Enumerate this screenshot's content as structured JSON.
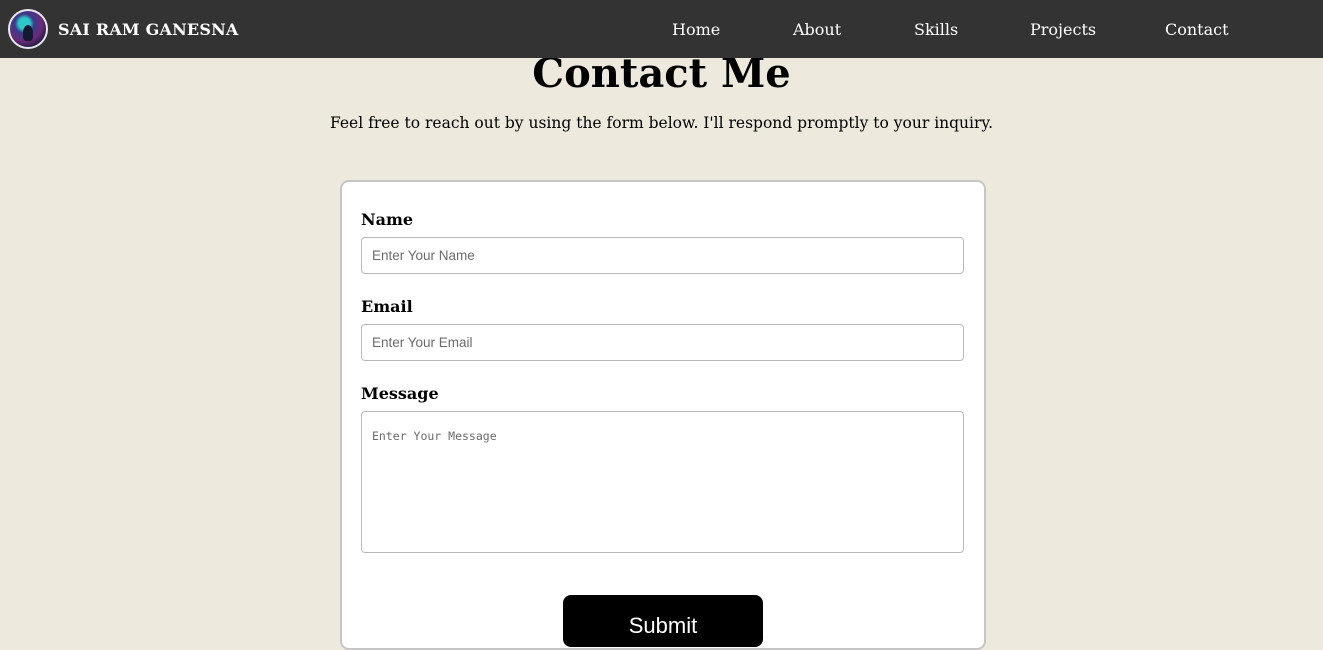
{
  "navbar": {
    "brand_name": "SAI RAM GANESNA",
    "links": [
      {
        "label": "Home"
      },
      {
        "label": "About"
      },
      {
        "label": "Skills"
      },
      {
        "label": "Projects"
      },
      {
        "label": "Contact"
      }
    ]
  },
  "contact": {
    "title": "Contact Me",
    "intro": "Feel free to reach out by using the form below. I'll respond promptly to your inquiry."
  },
  "form": {
    "name_label": "Name",
    "name_placeholder": "Enter Your Name",
    "name_value": "",
    "email_label": "Email",
    "email_placeholder": "Enter Your Email",
    "email_value": "",
    "message_label": "Message",
    "message_placeholder": "Enter Your Message",
    "message_value": "",
    "submit_label": "Submit"
  },
  "colors": {
    "navbar_bg": "#333333",
    "page_bg": "#ede9dd",
    "button_bg": "#000000"
  }
}
